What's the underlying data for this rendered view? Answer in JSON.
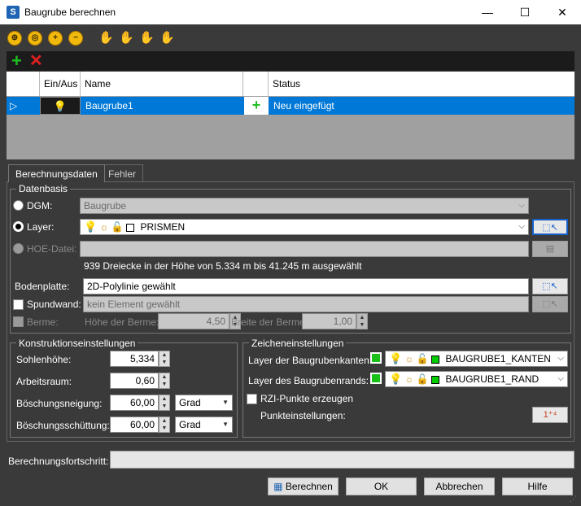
{
  "window": {
    "title": "Baugrube berechnen"
  },
  "grid": {
    "headers": {
      "onoff": "Ein/Aus",
      "name": "Name",
      "status": "Status"
    },
    "rows": [
      {
        "name": "Baugrube1",
        "status": "Neu eingefügt"
      }
    ]
  },
  "tabs": {
    "calc": "Berechnungsdaten",
    "errors": "Fehler"
  },
  "datenbasis": {
    "title": "Datenbasis",
    "dgm_label": "DGM:",
    "dgm_value": "Baugrube",
    "layer_label": "Layer:",
    "layer_value": "PRISMEN",
    "hoe_label": "HOE-Datei:",
    "hoe_value": "",
    "info": "939 Dreiecke in der Höhe von 5.334 m bis 41.245 m ausgewählt",
    "bodenplatte_label": "Bodenplatte:",
    "bodenplatte_value": "2D-Polylinie gewählt",
    "spundwand_label": "Spundwand:",
    "spundwand_value": "kein Element gewählt",
    "berme_label": "Berme:",
    "hoehe_berme_label": "Höhe der Berme:",
    "hoehe_berme_value": "4,50",
    "breite_berme_label": "Breite der Berme:",
    "breite_berme_value": "1,00"
  },
  "konstruktion": {
    "title": "Konstruktionseinstellungen",
    "sohlenhoehe_label": "Sohlenhöhe:",
    "sohlenhoehe_value": "5,334",
    "arbeitsraum_label": "Arbeitsraum:",
    "arbeitsraum_value": "0,60",
    "neigung_label": "Böschungsneigung:",
    "neigung_value": "60,00",
    "neigung_unit": "Grad",
    "schuettung_label": "Böschungsschüttung:",
    "schuettung_value": "60,00",
    "schuettung_unit": "Grad"
  },
  "zeichen": {
    "title": "Zeicheneinstellungen",
    "kanten_label": "Layer der Baugrubenkanten:",
    "kanten_value": "BAUGRUBE1_KANTEN",
    "rand_label": "Layer des Baugrubenrands:",
    "rand_value": "BAUGRUBE1_RAND",
    "rzi_label": "RZI-Punkte erzeugen",
    "punkt_label": "Punkteinstellungen:"
  },
  "progress": {
    "label": "Berechnungsfortschritt:"
  },
  "buttons": {
    "berechnen": "Berechnen",
    "ok": "OK",
    "abbrechen": "Abbrechen",
    "hilfe": "Hilfe"
  },
  "colors": {
    "selection": "#0078d7",
    "layer_green": "#18c018",
    "background": "#3a3a3a"
  },
  "icons": [
    "zoom-extents-icon",
    "zoom-out-icon",
    "zoom-in-icon",
    "zoom-minus-icon",
    "pan-hand-icon",
    "pan-hand-icon",
    "pan-hand-icon",
    "pan-hand-icon"
  ]
}
